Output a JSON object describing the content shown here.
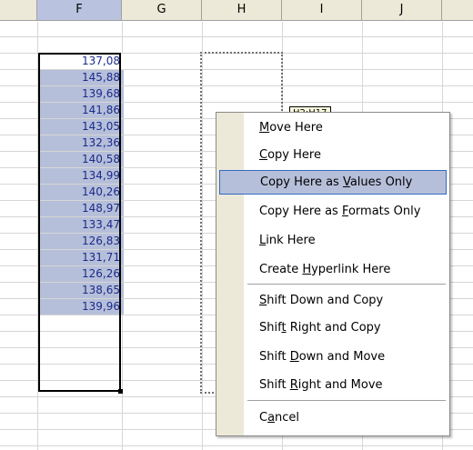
{
  "columns": [
    {
      "label": "F",
      "selected": true
    },
    {
      "label": "G",
      "selected": false
    },
    {
      "label": "H",
      "selected": false
    },
    {
      "label": "I",
      "selected": false
    },
    {
      "label": "J",
      "selected": false
    }
  ],
  "column_f_values": [
    "137,08",
    "145,88",
    "139,68",
    "141,86",
    "143,05",
    "132,36",
    "140,58",
    "134,99",
    "140,26",
    "148,97",
    "133,47",
    "126,83",
    "131,71",
    "126,26",
    "138,65",
    "139,96"
  ],
  "drag_tooltip": "H2:H17",
  "context_menu": {
    "items": [
      {
        "pre": "",
        "key": "M",
        "post": "ove Here",
        "highlighted": false
      },
      {
        "pre": "",
        "key": "C",
        "post": "opy Here",
        "highlighted": false
      },
      {
        "pre": "Copy Here as ",
        "key": "V",
        "post": "alues Only",
        "highlighted": true
      },
      {
        "pre": "Copy Here as ",
        "key": "F",
        "post": "ormats Only",
        "highlighted": false
      },
      {
        "pre": "",
        "key": "L",
        "post": "ink Here",
        "highlighted": false
      },
      {
        "pre": "Create ",
        "key": "H",
        "post": "yperlink Here",
        "highlighted": false
      },
      {
        "pre": "",
        "key": "S",
        "post": "hift Down and Copy",
        "highlighted": false
      },
      {
        "pre": "Shif",
        "key": "t",
        "post": " Right and Copy",
        "highlighted": false
      },
      {
        "pre": "Shift ",
        "key": "D",
        "post": "own and Move",
        "highlighted": false
      },
      {
        "pre": "Shift ",
        "key": "R",
        "post": "ight and Move",
        "highlighted": false
      },
      {
        "pre": "C",
        "key": "a",
        "post": "ncel",
        "highlighted": false
      }
    ]
  }
}
